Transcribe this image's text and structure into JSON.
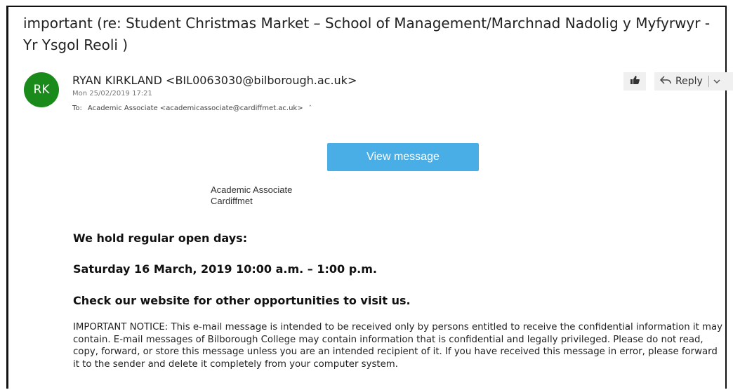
{
  "email": {
    "subject": "important (re: Student Christmas Market – School of Management/Marchnad Nadolig y Myfyrwyr - Yr Ysgol Reoli )",
    "avatar_initials": "RK",
    "avatar_color": "#1a8a1a",
    "sender": "RYAN KIRKLAND <BIL0063030@bilborough.ac.uk>",
    "date": "Mon 25/02/2019 17:21",
    "to_label": "To:",
    "to_value": "Academic Associate <academicassociate@cardiffmet.ac.uk>",
    "to_caret": "ˆ"
  },
  "toolbar": {
    "react_icon": "like-icon",
    "reply_label": "Reply",
    "reply_icon": "reply-arrow-icon",
    "dropdown_icon": "chevron-down-icon"
  },
  "body": {
    "view_button_label": "View message",
    "view_button_color": "#4aaee6",
    "recipient_line1": "Academic Associate",
    "recipient_line2": "Cardiffmet",
    "open_days": "We hold regular open days:",
    "date_line": "Saturday 16 March, 2019 10:00 a.m. – 1:00 p.m.",
    "website_line": "Check our website for other opportunities to visit us.",
    "notice": "IMPORTANT NOTICE: This e-mail message is intended to be received only by persons entitled to receive the confidential information it may contain. E-mail messages of Bilborough College may contain information that is confidential and legally privileged. Please do not read, copy, forward, or store this message unless you are an intended recipient of it. If you have received this message in error, please forward it to the sender and delete it completely from your computer system."
  }
}
